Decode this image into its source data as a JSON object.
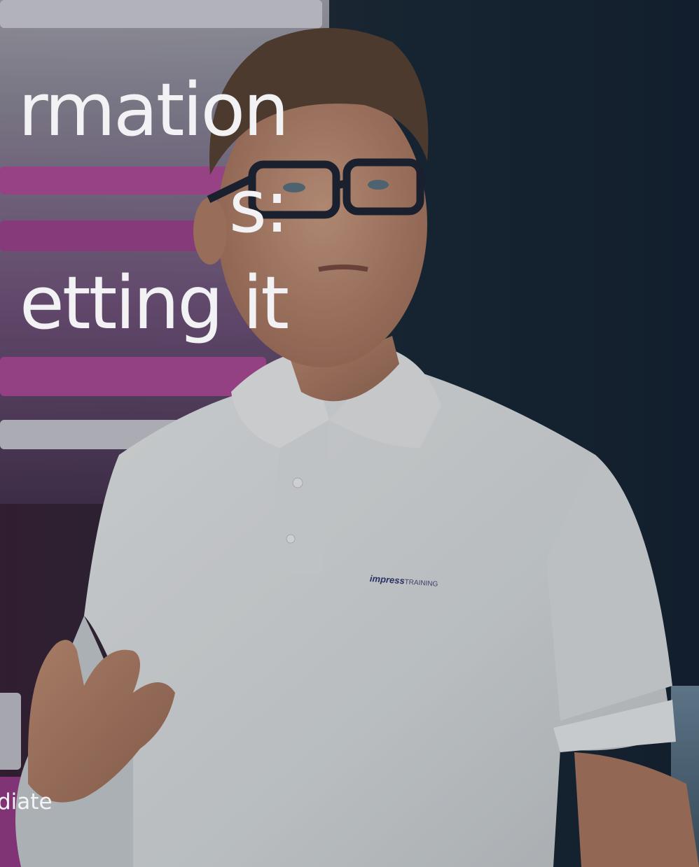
{
  "hero": {
    "headline_lines": [
      "rmation",
      "s:",
      "etting it"
    ],
    "level_label": "diate"
  },
  "shirt_logo": {
    "brand": "impress",
    "suffix": "TRAINING"
  },
  "colors": {
    "text": "#f2f2f4",
    "accent_pink": "#b54d9e",
    "background_dark": "#142232",
    "shirt": "#e8ecee"
  },
  "icons": {
    "logo": "impress-logo-icon"
  }
}
